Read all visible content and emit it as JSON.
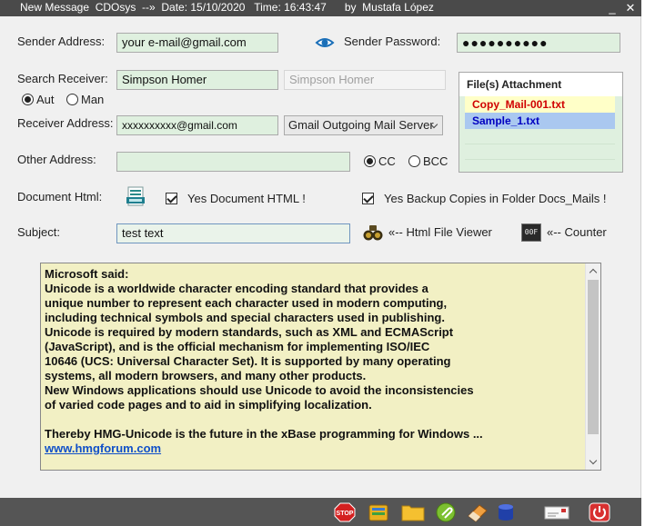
{
  "window": {
    "title": "New Message  CDOsys  --»  Date: 15/10/2020   Time: 16:43:47      by  Mustafa López",
    "minimize_label": "_",
    "close_label": "✕"
  },
  "sender": {
    "address_label": "Sender Address:",
    "address_value": "your e-mail@gmail.com",
    "password_label": "Sender Password:",
    "password_value": "●●●●●●●●●●"
  },
  "receiver": {
    "search_label": "Search Receiver:",
    "search_value": "Simpson Homer",
    "search_result": "Simpson Homer",
    "mode_auto": "Aut",
    "mode_manual": "Man",
    "address_label": "Receiver Address:",
    "address_value": "xxxxxxxxxx@gmail.com",
    "server_selected": "Gmail   Outgoing Mail Server"
  },
  "attachments": {
    "header": "File(s)  Attachment",
    "items": [
      "Copy_Mail-001.txt",
      "Sample_1.txt"
    ]
  },
  "other": {
    "label": "Other Address:",
    "value": "",
    "cc_label": "CC",
    "bcc_label": "BCC"
  },
  "document": {
    "label": "Document Html:",
    "html_check_label": "Yes Document HTML !",
    "backup_check_label": "Yes Backup Copies in Folder Docs_Mails !"
  },
  "subject": {
    "label": "Subject:",
    "value": "test text",
    "viewer_label": "«-- Html File Viewer",
    "counter_label": "«-- Counter"
  },
  "body": {
    "lines": [
      "Microsoft said:",
      "Unicode is a worldwide character encoding standard that provides a",
      "unique number to represent each character used in modern computing,",
      "including technical symbols and special characters used in publishing.",
      "Unicode is required by modern standards, such as XML and ECMAScript",
      "(JavaScript), and is the official mechanism for implementing ISO/IEC",
      "10646 (UCS: Universal Character Set). It is supported by many operating",
      "systems, all modern browsers, and many other products.",
      "New Windows applications should use Unicode to avoid the inconsistencies",
      "of varied code pages and to aid in simplifying localization.",
      "",
      "Thereby HMG-Unicode is the future in the xBase programming for Windows ..."
    ],
    "link": "www.hmgforum.com"
  },
  "icons": {
    "stop_label": "STOP",
    "counter_icon_label": "00F"
  },
  "colors": {
    "field_bg": "#dff0df",
    "memo_bg": "#f2f0c4",
    "titlebar_bg": "#4a4a4a",
    "attachment_red": "#d00000",
    "attachment_blue": "#0000c0"
  }
}
